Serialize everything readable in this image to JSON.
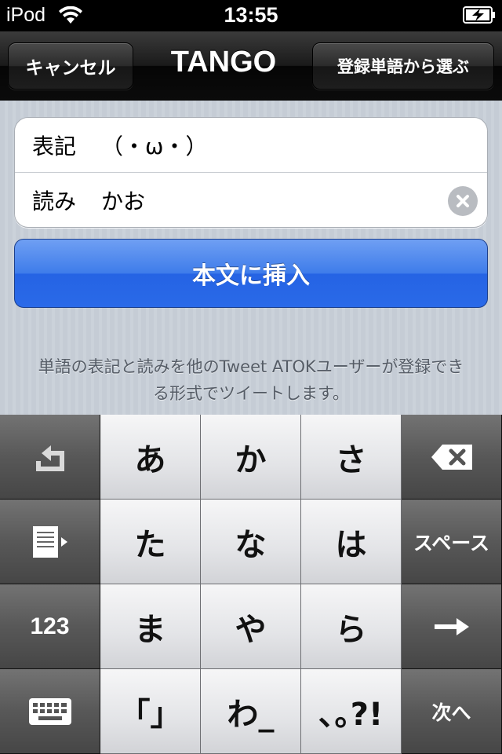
{
  "status_bar": {
    "carrier": "iPod",
    "time": "13:55"
  },
  "nav": {
    "cancel_label": "キャンセル",
    "title": "TANGO",
    "select_label": "登録単語から選ぶ"
  },
  "form": {
    "notation_label": "表記",
    "notation_value": "（・ω・）",
    "reading_label": "読み",
    "reading_value": "かお"
  },
  "insert_button_label": "本文に挿入",
  "help_text": {
    "line1": "単語の表記と読みを他のTweet ATOKユーザーが登録でき",
    "line2": "る形式でツイートします。"
  },
  "keyboard": {
    "kana": [
      "あ",
      "か",
      "さ",
      "た",
      "な",
      "は",
      "ま",
      "や",
      "ら",
      "「」",
      "わ_",
      "､｡?!"
    ],
    "space_label": "スペース",
    "mode_label": "123",
    "next_label": "次へ"
  },
  "colors": {
    "accent_blue": "#2a6ae8",
    "nav_bg": "#111111"
  }
}
